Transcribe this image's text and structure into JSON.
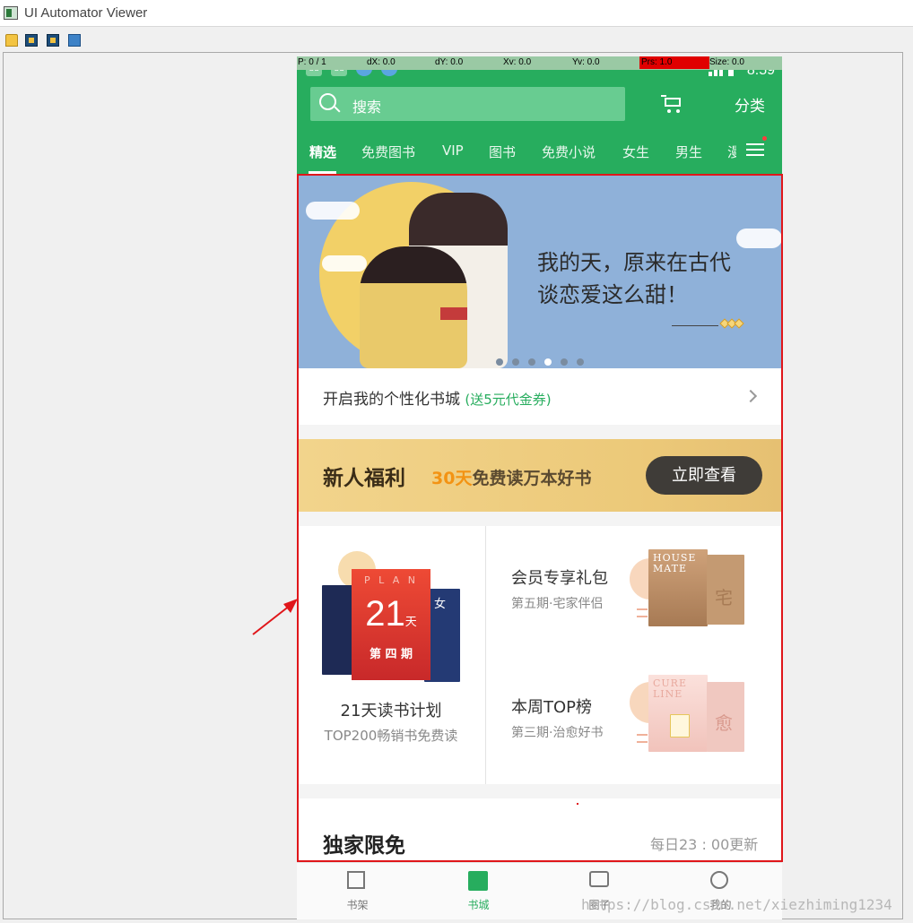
{
  "window": {
    "title": "UI Automator Viewer"
  },
  "toolbar": {
    "items": [
      {
        "name": "open-icon"
      },
      {
        "name": "device-screenshot-icon"
      },
      {
        "name": "device-screenshot-compressed-icon"
      },
      {
        "name": "save-icon"
      }
    ]
  },
  "pointer_location": {
    "p": "P: 0 / 1",
    "dx": "dX: 0.0",
    "dy": "dY: 0.0",
    "xv": "Xv: 0.0",
    "yv": "Yv: 0.0",
    "prs": "Prs: 1.0",
    "size": "Size: 0.0"
  },
  "status_bar": {
    "time": "8:59",
    "notifications": [
      "du",
      "du",
      "",
      ""
    ]
  },
  "header": {
    "search_placeholder": "搜索",
    "category": "分类",
    "tabs": [
      "精选",
      "免费图书",
      "VIP",
      "图书",
      "免费小说",
      "女生",
      "男生",
      "漫"
    ],
    "active_tab": "精选"
  },
  "banner": {
    "line1": "我的天，原来在古代",
    "line2": "谈恋爱这么甜！",
    "dots_count": 6,
    "active_dot": 3
  },
  "personal_row": {
    "text": "开启我的个性化书城",
    "badge": "(送5元代金券)"
  },
  "promo": {
    "title": "新人福利",
    "sub_highlight": "30天",
    "sub_rest": "免费读万本好书",
    "button": "立即查看"
  },
  "grid": {
    "plan": {
      "cover_top": "P L A N",
      "cover_number": "21",
      "cover_unit": "天",
      "cover_tag": "第 四 期",
      "side_book_char": "女",
      "title": "21天读书计划",
      "subtitle": "TOP200畅销书免费读"
    },
    "member": {
      "title": "会员专享礼包",
      "subtitle": "第五期·宅家伴侣",
      "cover_text": "HOUSE MATE",
      "cover_char": "宅"
    },
    "weekly": {
      "title": "本周TOP榜",
      "subtitle": "第三期·治愈好书",
      "cover_text": "CURE LINE",
      "cover_char": "愈"
    }
  },
  "exclusive": {
    "title": "独家限免",
    "update": "每日23 : 00更新"
  },
  "bottom_nav": [
    {
      "label": "书架",
      "icon": "bookshelf-icon"
    },
    {
      "label": "书城",
      "icon": "bookstore-icon",
      "active": true
    },
    {
      "label": "圈子",
      "icon": "community-icon"
    },
    {
      "label": "我的",
      "icon": "profile-icon"
    }
  ],
  "watermark": "https://blog.csdn.net/xiezhiming1234",
  "colors": {
    "brand_green": "#27ad5e",
    "highlight_red": "#e0161a",
    "promo_orange": "#f39313"
  }
}
